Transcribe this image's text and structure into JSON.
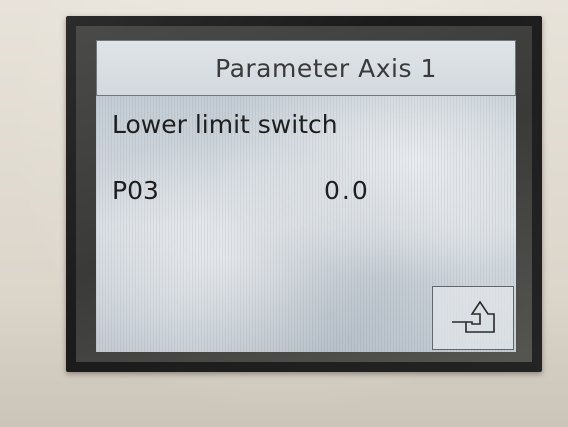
{
  "screen": {
    "title": "Parameter Axis 1",
    "section_label": "Lower limit switch",
    "parameter": {
      "code": "P03",
      "value": "0.0"
    },
    "return_button": {
      "icon": "return-arrow-icon"
    }
  }
}
